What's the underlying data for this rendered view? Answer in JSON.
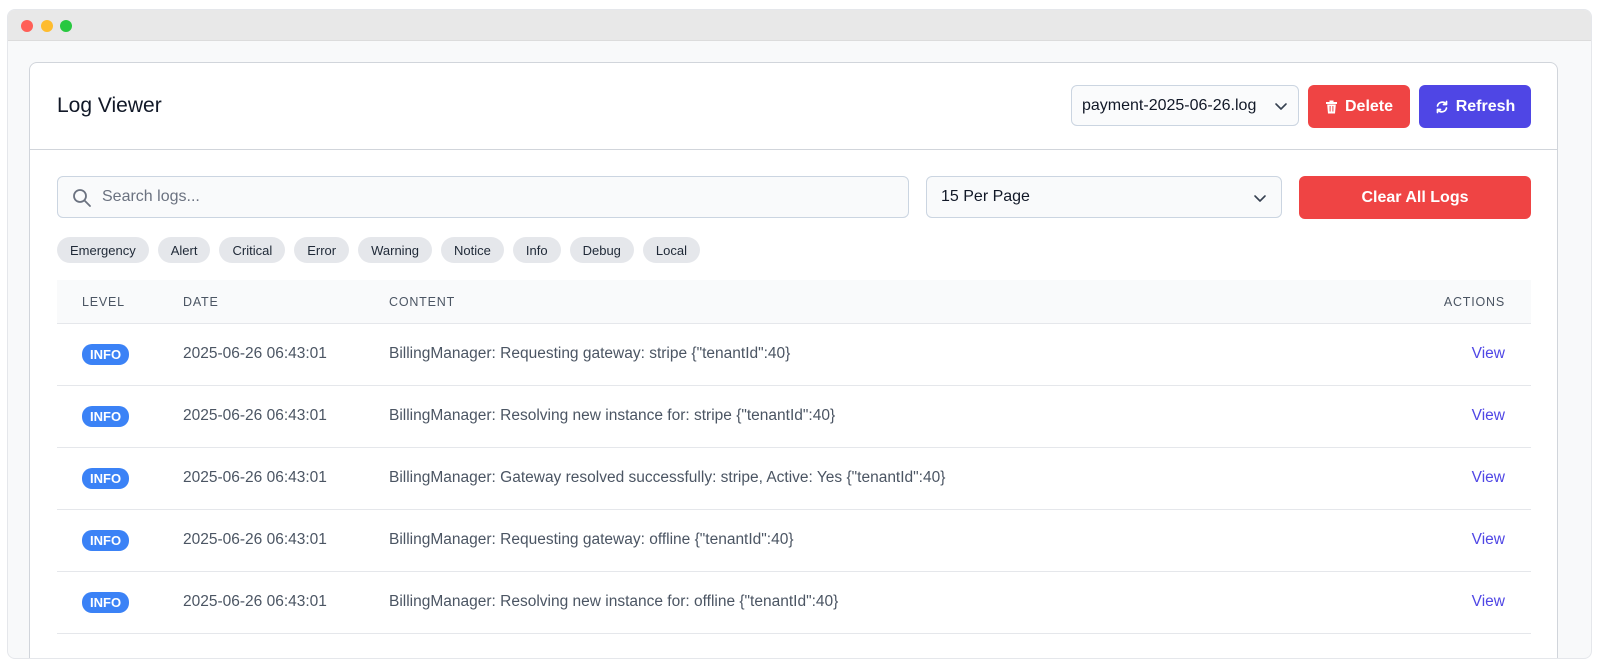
{
  "window": {
    "controls": [
      "close",
      "minimize",
      "maximize"
    ]
  },
  "header": {
    "title": "Log Viewer",
    "file_select": "payment-2025-06-26.log",
    "delete_label": "Delete",
    "refresh_label": "Refresh"
  },
  "toolbar": {
    "search_placeholder": "Search logs...",
    "per_page": "15 Per Page",
    "clear_label": "Clear All Logs"
  },
  "filters": [
    "Emergency",
    "Alert",
    "Critical",
    "Error",
    "Warning",
    "Notice",
    "Info",
    "Debug",
    "Local"
  ],
  "table": {
    "headers": {
      "level": "LEVEL",
      "date": "DATE",
      "content": "CONTENT",
      "actions": "ACTIONS"
    },
    "rows": [
      {
        "level": "INFO",
        "date": "2025-06-26 06:43:01",
        "content": "BillingManager: Requesting gateway: stripe {\"tenantId\":40}",
        "action": "View"
      },
      {
        "level": "INFO",
        "date": "2025-06-26 06:43:01",
        "content": "BillingManager: Resolving new instance for: stripe {\"tenantId\":40}",
        "action": "View"
      },
      {
        "level": "INFO",
        "date": "2025-06-26 06:43:01",
        "content": "BillingManager: Gateway resolved successfully: stripe, Active: Yes {\"tenantId\":40}",
        "action": "View"
      },
      {
        "level": "INFO",
        "date": "2025-06-26 06:43:01",
        "content": "BillingManager: Requesting gateway: offline {\"tenantId\":40}",
        "action": "View"
      },
      {
        "level": "INFO",
        "date": "2025-06-26 06:43:01",
        "content": "BillingManager: Resolving new instance for: offline {\"tenantId\":40}",
        "action": "View"
      }
    ]
  },
  "colors": {
    "danger": "#ef4444",
    "primary": "#4f46e5",
    "info_badge": "#3b82f6",
    "link": "#4f46e5"
  }
}
